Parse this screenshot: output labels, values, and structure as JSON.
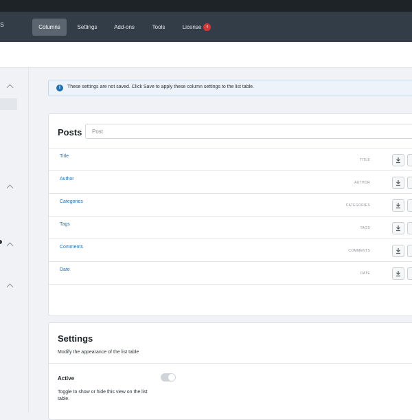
{
  "nav": {
    "edge_label": "S",
    "items": [
      {
        "label": "Columns",
        "active": true
      },
      {
        "label": "Settings"
      },
      {
        "label": "Add-ons"
      },
      {
        "label": "Tools"
      },
      {
        "label": "License",
        "badge": "!"
      }
    ]
  },
  "notice": {
    "icon": "info-icon",
    "text": "These settings are not saved. Click Save to apply these column settings to the list table."
  },
  "posts": {
    "title": "Posts",
    "input_placeholder": "Post",
    "columns": [
      {
        "label": "Title",
        "type": "TITLE"
      },
      {
        "label": "Author",
        "type": "AUTHOR"
      },
      {
        "label": "Categories",
        "type": "CATEGORIES"
      },
      {
        "label": "Tags",
        "type": "TAGS"
      },
      {
        "label": "Comments",
        "type": "COMMENTS"
      },
      {
        "label": "Date",
        "type": "DATE"
      }
    ]
  },
  "settings": {
    "title": "Settings",
    "description": "Modify the appearance of the list table",
    "active_label": "Active",
    "active_description": "Toggle to show or hide this view on the list table.",
    "active_enabled": false
  },
  "colors": {
    "top_strip": "#1d2327",
    "navbar": "#333d48",
    "link": "#2271b1",
    "badge": "#d63638"
  }
}
